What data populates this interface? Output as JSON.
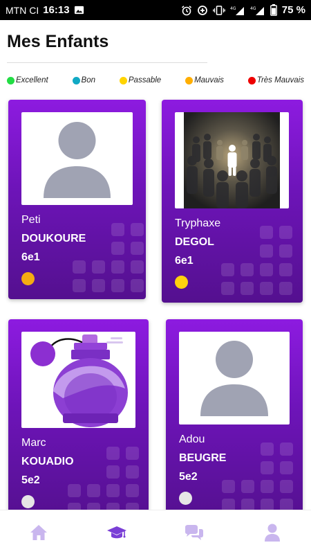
{
  "status_bar": {
    "carrier": "MTN CI",
    "time": "16:13",
    "battery": "75 %",
    "icons": [
      "image-icon",
      "alarm-icon",
      "data-saver-icon",
      "vibrate-icon",
      "signal-4g-icon",
      "signal-icon",
      "battery-icon"
    ]
  },
  "header": {
    "title": "Mes Enfants"
  },
  "legend": [
    {
      "label": "Excellent",
      "color": "#22dd44"
    },
    {
      "label": "Bon",
      "color": "#11a9c4"
    },
    {
      "label": "Passable",
      "color": "#ffd400"
    },
    {
      "label": "Mauvais",
      "color": "#ffae00"
    },
    {
      "label": "Très Mauvais",
      "color": "#ee0000"
    }
  ],
  "children": [
    {
      "first_name": "Peti",
      "last_name": "DOUKOURE",
      "class": "6e1",
      "status_color": "#f5ab12",
      "photo": "avatar-placeholder"
    },
    {
      "first_name": "Tryphaxe",
      "last_name": "DEGOL",
      "class": "6e1",
      "status_color": "#ffd20d",
      "photo": "crowd-light-photo"
    },
    {
      "first_name": "Marc",
      "last_name": "KOUADIO",
      "class": "5e2",
      "status_color": "#e6e6e6",
      "photo": "perfume-illustration"
    },
    {
      "first_name": "Adou",
      "last_name": "BEUGRE",
      "class": "5e2",
      "status_color": "#e6e6e6",
      "photo": "avatar-placeholder"
    }
  ],
  "bottom_nav": {
    "items": [
      {
        "icon": "home-icon",
        "active": false
      },
      {
        "icon": "graduation-cap-icon",
        "active": true
      },
      {
        "icon": "chat-icon",
        "active": false
      },
      {
        "icon": "user-icon",
        "active": false
      }
    ],
    "active_color": "#7a3fd6",
    "inactive_color": "#c9b6ee"
  }
}
